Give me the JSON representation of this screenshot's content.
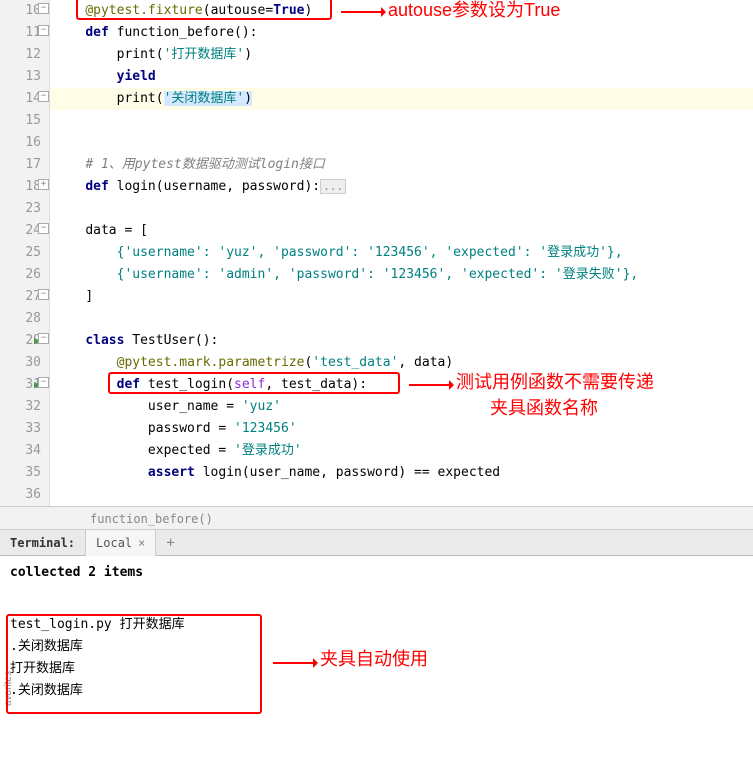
{
  "gutter": {
    "lines": [
      "10",
      "11",
      "12",
      "13",
      "14",
      "15",
      "16",
      "17",
      "18",
      "23",
      "24",
      "25",
      "26",
      "27",
      "28",
      "29",
      "30",
      "31",
      "32",
      "33",
      "34",
      "35",
      "36"
    ]
  },
  "code": {
    "l10_dec1": "@pytest",
    "l10_dec2": ".fixture",
    "l10_arg": "autouse=",
    "l10_true": "True",
    "l11_def": "def",
    "l11_name": " function_before():",
    "l12_print": "print",
    "l12_str": "'打开数据库'",
    "l13_yield": "yield",
    "l14_print": "print",
    "l14_str": "'关闭数据库'",
    "l17_comment": "# 1、用pytest数据驱动测试login接口",
    "l18_def": "def",
    "l18_sig": " login(username, password):",
    "l18_dots": "...",
    "l24_data": "data = [",
    "l25_line": "    {'username': 'yuz', 'password': '123456', 'expected': '登录成功'},",
    "l26_line": "    {'username': 'admin', 'password': '123456', 'expected': '登录失败'},",
    "l27_close": "]",
    "l29_class": "class",
    "l29_name": " TestUser():",
    "l30_dec": "@pytest.mark.parametrize",
    "l30_arg1": "'test_data'",
    "l30_arg2": ", data)",
    "l31_def": "def",
    "l31_name": " test_login(",
    "l31_self": "self",
    "l31_rest": ", test_data):",
    "l32": "        user_name = ",
    "l32_str": "'yuz'",
    "l33": "        password = ",
    "l33_str": "'123456'",
    "l34": "        expected = ",
    "l34_str": "'登录成功'",
    "l35_assert": "assert",
    "l35_rest": " login(user_name, password) == expected"
  },
  "annotations": {
    "a1": "autouse参数设为True",
    "a2": "测试用例函数不需要传递",
    "a2b": "夹具函数名称",
    "a3": "夹具自动使用"
  },
  "breadcrumb": {
    "text": "function_before()"
  },
  "terminal": {
    "label": "Terminal:",
    "tab": "Local",
    "collected": "collected 2 items",
    "out1": "test_login.py 打开数据库",
    "out2": ".关闭数据库",
    "out3": "打开数据库",
    "out4": ".关闭数据库"
  },
  "side": {
    "label": "avorites"
  }
}
